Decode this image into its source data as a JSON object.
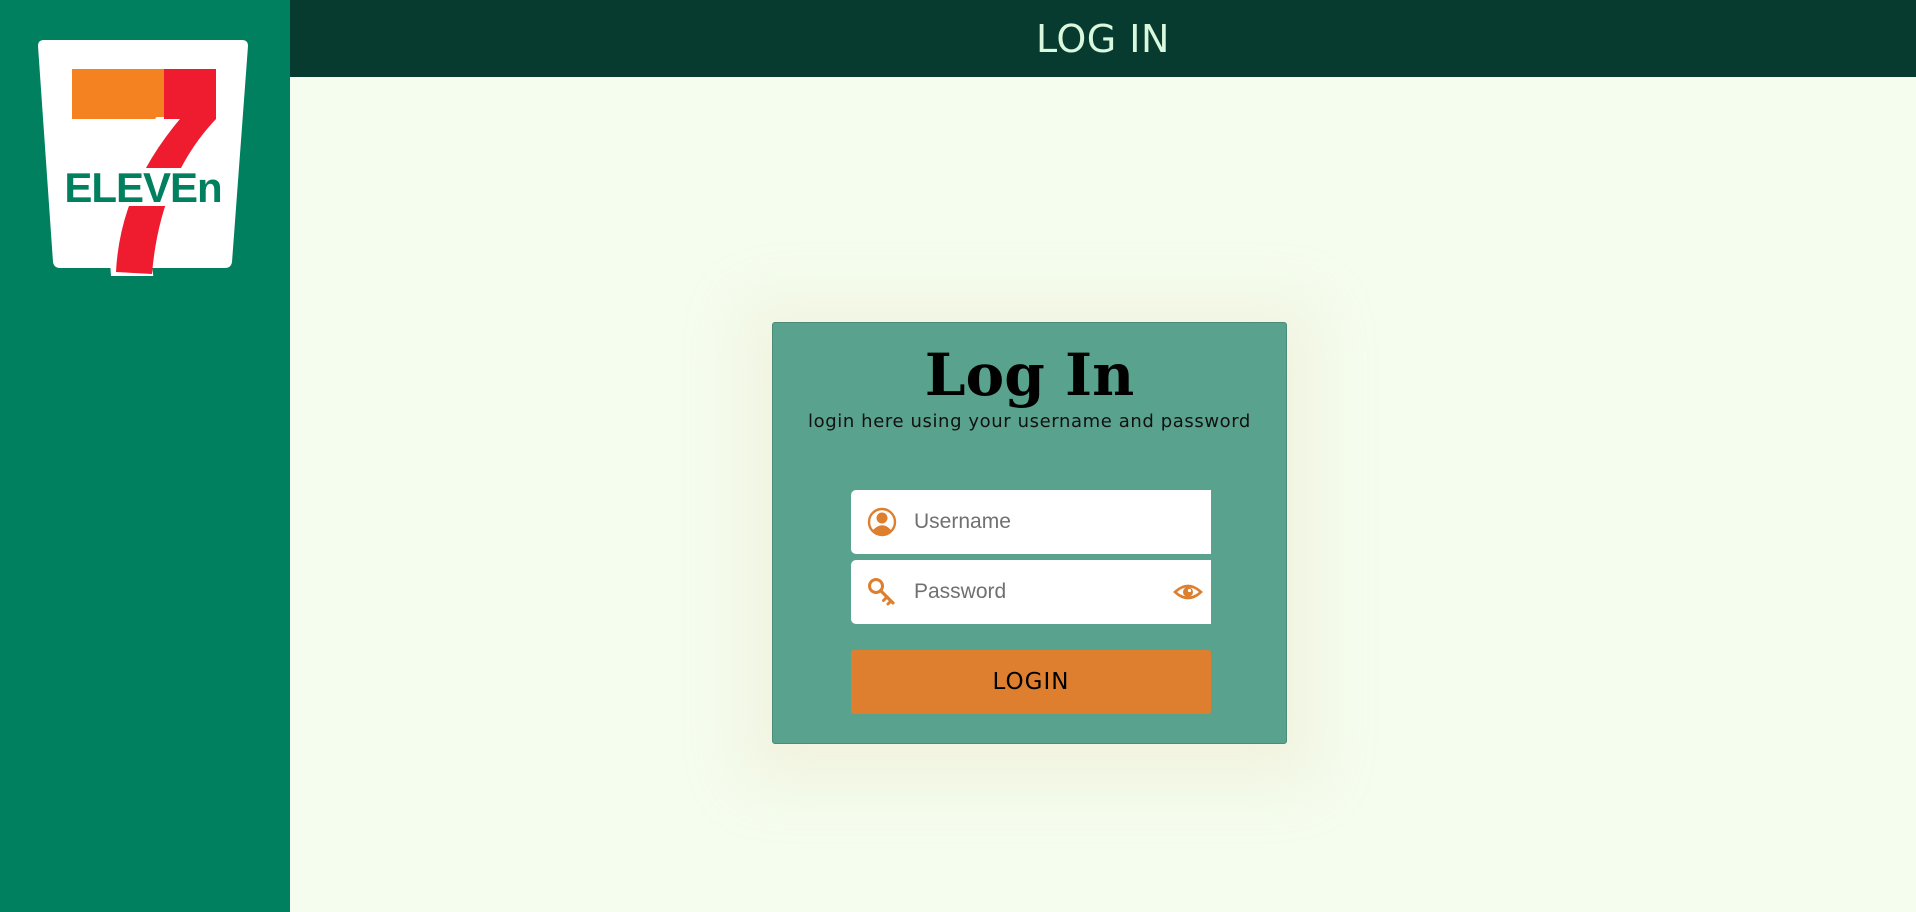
{
  "brand": {
    "logo_name": "7-Eleven",
    "logo_text": "ELEVEn",
    "colors": {
      "green": "#00805e",
      "orange": "#f58220",
      "red": "#ee1c2e"
    }
  },
  "header": {
    "title": "LOG IN"
  },
  "login_card": {
    "title": "Log In",
    "subtitle": "login here using your username and password",
    "username": {
      "placeholder": "Username",
      "value": "",
      "icon": "user-icon"
    },
    "password": {
      "placeholder": "Password",
      "value": "",
      "icon": "key-icon",
      "toggle_icon": "eye-icon"
    },
    "submit_label": "LOGIN"
  },
  "colors": {
    "sidebar": "#00805e",
    "topbar": "#073b30",
    "page_bg": "#f5fdef",
    "card_bg": "#59a28d",
    "accent": "#dd7f2f"
  }
}
